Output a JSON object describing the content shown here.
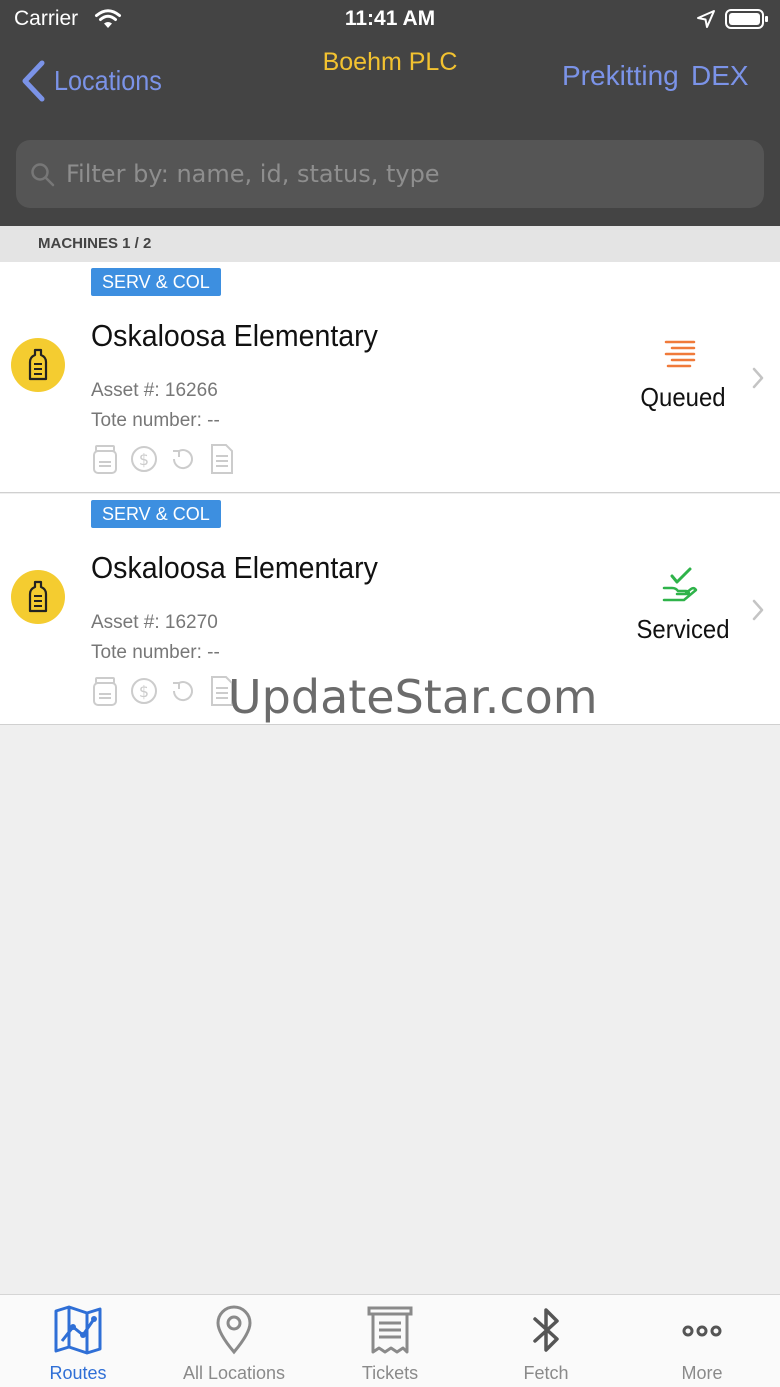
{
  "status_bar": {
    "carrier": "Carrier",
    "time": "11:41 AM"
  },
  "nav": {
    "back_label": "Locations",
    "title": "Boehm PLC",
    "right_buttons": [
      "Prekitting",
      "DEX"
    ]
  },
  "search": {
    "placeholder": "Filter by: name, id, status, type",
    "value": ""
  },
  "section": {
    "title": "MACHINES 1 / 2"
  },
  "machines": [
    {
      "tag": "SERV & COL",
      "name": "Oskaloosa Elementary",
      "asset": "Asset #: 16266",
      "tote": "Tote number: --",
      "status": "Queued",
      "status_icon": "queued-icon",
      "status_color": "#f07a3a"
    },
    {
      "tag": "SERV & COL",
      "name": "Oskaloosa Elementary",
      "asset": "Asset #: 16270",
      "tote": "Tote number: --",
      "status": "Serviced",
      "status_icon": "serviced-icon",
      "status_color": "#2fb34a"
    }
  ],
  "watermark": "UpdateStar.com",
  "tabbar": {
    "tabs": [
      {
        "label": "Routes",
        "icon": "map-icon",
        "active": true
      },
      {
        "label": "All Locations",
        "icon": "location-pin-icon",
        "active": false
      },
      {
        "label": "Tickets",
        "icon": "ticket-icon",
        "active": false
      },
      {
        "label": "Fetch",
        "icon": "bluetooth-icon",
        "active": false
      },
      {
        "label": "More",
        "icon": "more-icon",
        "active": false
      }
    ]
  },
  "colors": {
    "header_bg": "#444444",
    "accent_blue": "#7b93e8",
    "title_yellow": "#f2c230",
    "tag_blue": "#3d8fe0",
    "active_tab": "#2f6fd6"
  }
}
